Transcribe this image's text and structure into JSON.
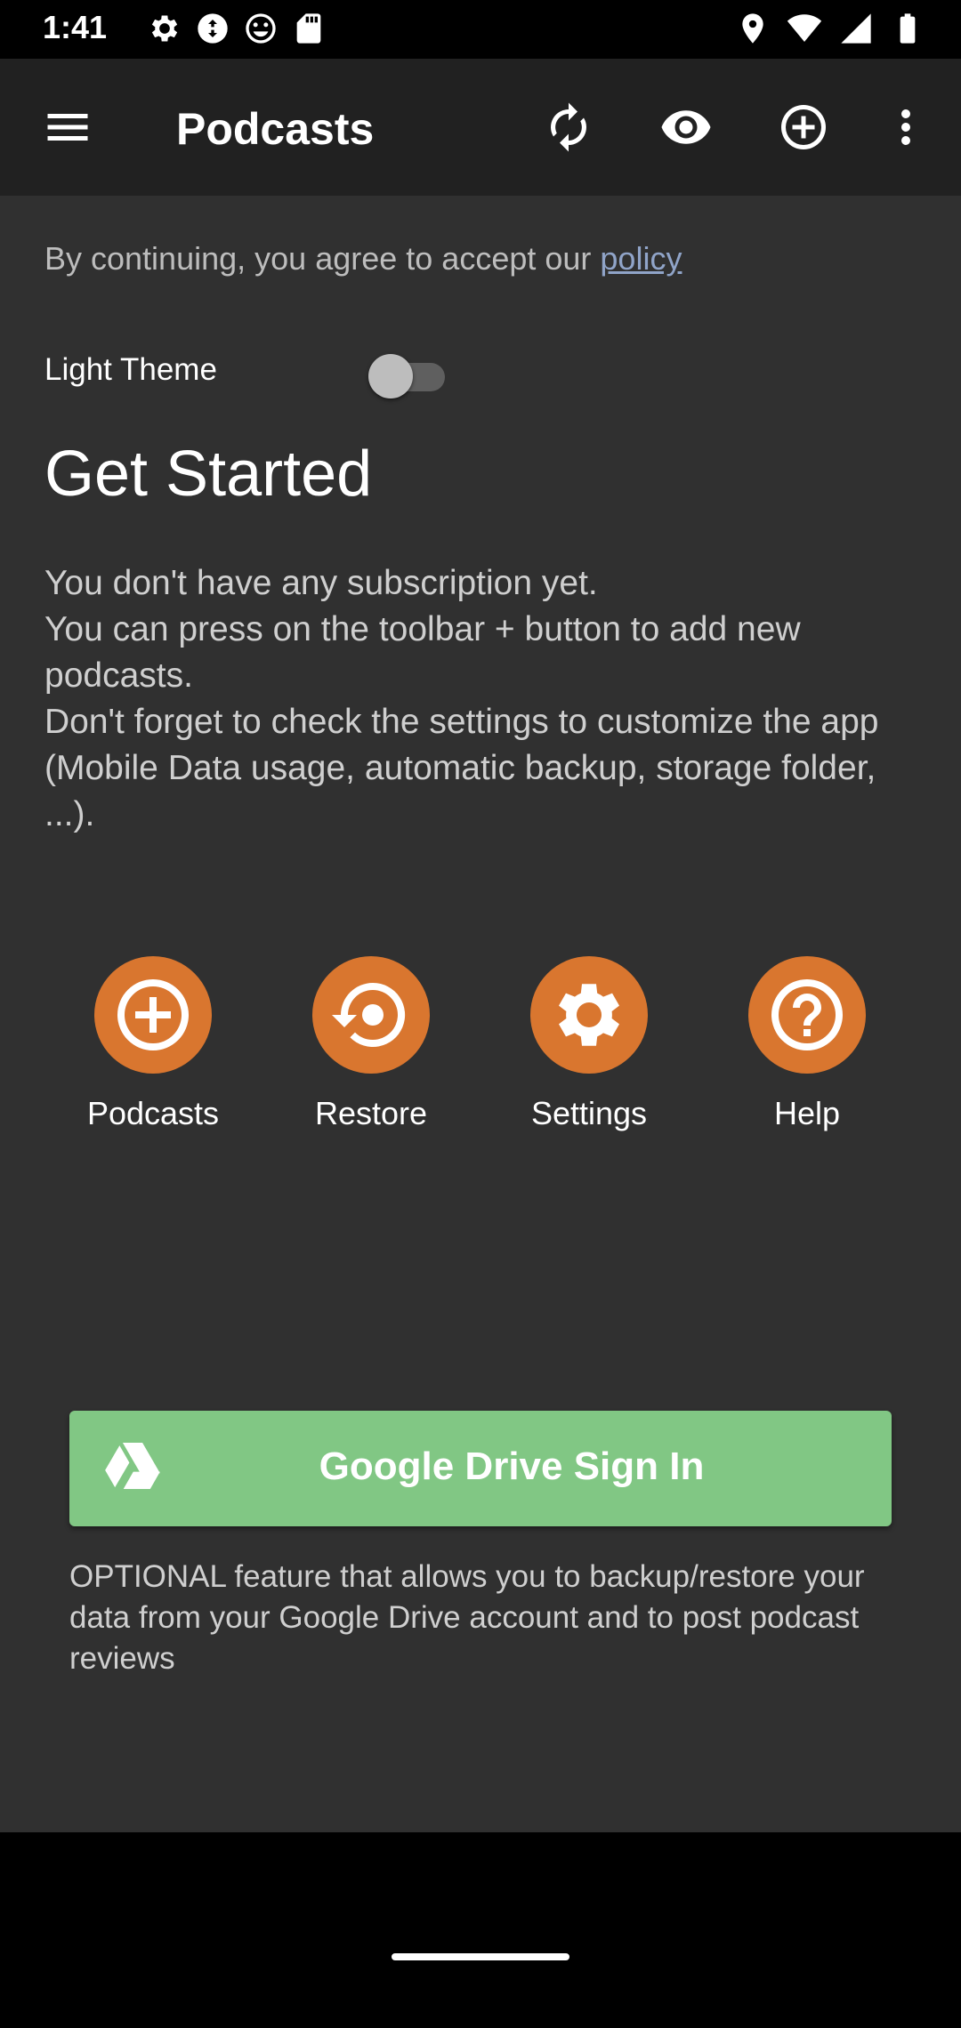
{
  "status_bar": {
    "time": "1:41",
    "left_icons": [
      "settings-icon",
      "sync-circle-icon",
      "smiley-icon",
      "sd-card-icon"
    ],
    "right_icons": [
      "location-icon",
      "wifi-icon",
      "signal-icon",
      "battery-icon"
    ]
  },
  "toolbar": {
    "title": "Podcasts",
    "icons": [
      "menu-icon",
      "refresh-icon",
      "eye-icon",
      "add-circle-icon",
      "more-vert-icon"
    ]
  },
  "policy": {
    "text": "By continuing, you agree to accept our ",
    "link": "policy"
  },
  "theme": {
    "label": "Light Theme",
    "enabled": false
  },
  "get_started": {
    "title": "Get Started",
    "lines": [
      "You don't have any subscription yet.",
      "You can press on the toolbar + button to add new podcasts.",
      "Don't forget to check the settings to customize the app (Mobile Data usage, automatic backup, storage folder, ...)."
    ]
  },
  "actions": [
    {
      "label": "Podcasts",
      "icon": "add-circle-icon"
    },
    {
      "label": "Restore",
      "icon": "restore-icon"
    },
    {
      "label": "Settings",
      "icon": "gear-icon"
    },
    {
      "label": "Help",
      "icon": "help-icon"
    }
  ],
  "gdrive": {
    "label": "Google Drive Sign In",
    "description": "OPTIONAL feature that allows you to backup/restore your data from your Google Drive account and to post podcast reviews"
  },
  "colors": {
    "toolbar": "#212121",
    "background": "#303030",
    "accent": "#d9762f",
    "gdrive_button": "#81c784"
  }
}
